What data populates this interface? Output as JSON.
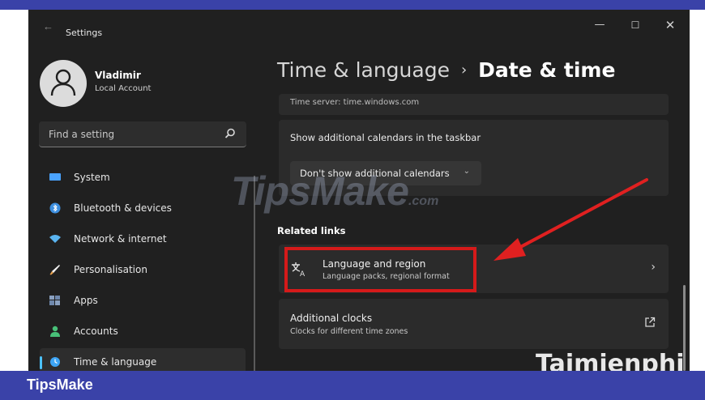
{
  "app": {
    "title": "Settings",
    "controls": {
      "minimize": "—",
      "maximize": "☐",
      "close": "✕"
    }
  },
  "user": {
    "name": "Vladimir",
    "account_type": "Local Account"
  },
  "search": {
    "placeholder": "Find a setting",
    "icon": "search-icon"
  },
  "sidebar": {
    "items": [
      {
        "label": "System",
        "icon": "system-icon",
        "color": "#4aa3ff"
      },
      {
        "label": "Bluetooth & devices",
        "icon": "bluetooth-icon",
        "color": "#3d8fe0"
      },
      {
        "label": "Network & internet",
        "icon": "network-icon",
        "color": "#5ab4f0"
      },
      {
        "label": "Personalisation",
        "icon": "brush-icon",
        "color": "#e8a04c"
      },
      {
        "label": "Apps",
        "icon": "apps-icon",
        "color": "#8aa0c0"
      },
      {
        "label": "Accounts",
        "icon": "accounts-icon",
        "color": "#48c078"
      },
      {
        "label": "Time & language",
        "icon": "time-language-icon",
        "color": "#3da5f5",
        "active": true
      }
    ]
  },
  "header": {
    "parent": "Time & language",
    "separator": "›",
    "current": "Date & time"
  },
  "main": {
    "time_server": "Time server: time.windows.com",
    "calendars": {
      "title": "Show additional calendars in the taskbar",
      "dropdown_value": "Don't show additional calendars",
      "chevron": "⌄"
    },
    "related_links_heading": "Related links",
    "language_region": {
      "title": "Language and region",
      "subtitle": "Language packs, regional format",
      "chevron": "›",
      "icon": "language-icon"
    },
    "additional_clocks": {
      "title": "Additional clocks",
      "subtitle": "Clocks for different time zones",
      "icon": "external-link-icon"
    }
  },
  "watermarks": {
    "center_main": "TipsMake",
    "center_suffix": ".com",
    "corner": "Taimienphi"
  },
  "footer": {
    "brand": "TipsMake"
  },
  "colors": {
    "window_bg": "#202020",
    "card_bg": "#2b2b2b",
    "accent": "#4cc2ff",
    "highlight_red": "#d51a1a",
    "band_blue": "#3a42a8"
  }
}
